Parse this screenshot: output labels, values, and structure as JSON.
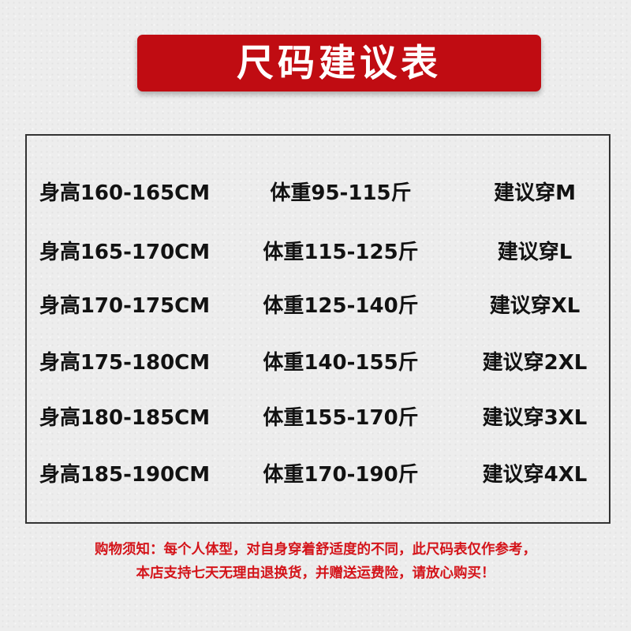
{
  "title": "尺码建议表",
  "size_chart": {
    "rows": [
      {
        "height": "身高160-165CM",
        "weight": "体重95-115斤",
        "size": "建议穿M"
      },
      {
        "height": "身高165-170CM",
        "weight": "体重115-125斤",
        "size": "建议穿L"
      },
      {
        "height": "身高170-175CM",
        "weight": "体重125-140斤",
        "size": "建议穿XL"
      },
      {
        "height": "身高175-180CM",
        "weight": "体重140-155斤",
        "size": "建议穿2XL"
      },
      {
        "height": "身高180-185CM",
        "weight": "体重155-170斤",
        "size": "建议穿3XL"
      },
      {
        "height": "身高185-190CM",
        "weight": "体重170-190斤",
        "size": "建议穿4XL"
      }
    ]
  },
  "notice": {
    "line1": "购物须知：每个人体型，对自身穿着舒适度的不同，此尺码表仅作参考，",
    "line2": "本店支持七天无理由退换货，并赠送运费险，请放心购买！"
  },
  "colors": {
    "banner": "#c00c12",
    "notice_text": "#d4141a",
    "background": "#ededed",
    "table_border": "#333333"
  }
}
